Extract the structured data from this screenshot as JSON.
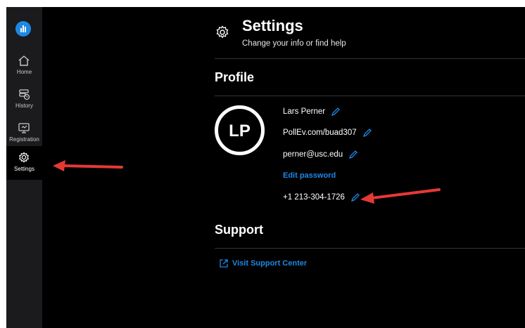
{
  "sidebar": {
    "items": [
      {
        "label": "Home",
        "icon": "home-icon"
      },
      {
        "label": "History",
        "icon": "history-icon"
      },
      {
        "label": "Registration",
        "icon": "registration-icon"
      },
      {
        "label": "Settings",
        "icon": "gear-icon"
      }
    ],
    "active": "Settings"
  },
  "header": {
    "title": "Settings",
    "subtitle": "Change your info or find help"
  },
  "profile": {
    "section_title": "Profile",
    "initials": "LP",
    "name": "Lars Perner",
    "url": "PollEv.com/buad307",
    "email": "perner@usc.edu",
    "edit_password": "Edit password",
    "phone": "+1 213-304-1726"
  },
  "support": {
    "section_title": "Support",
    "link_label": "Visit Support Center"
  },
  "colors": {
    "accent": "#1e88e5",
    "annotation": "#e53935"
  }
}
